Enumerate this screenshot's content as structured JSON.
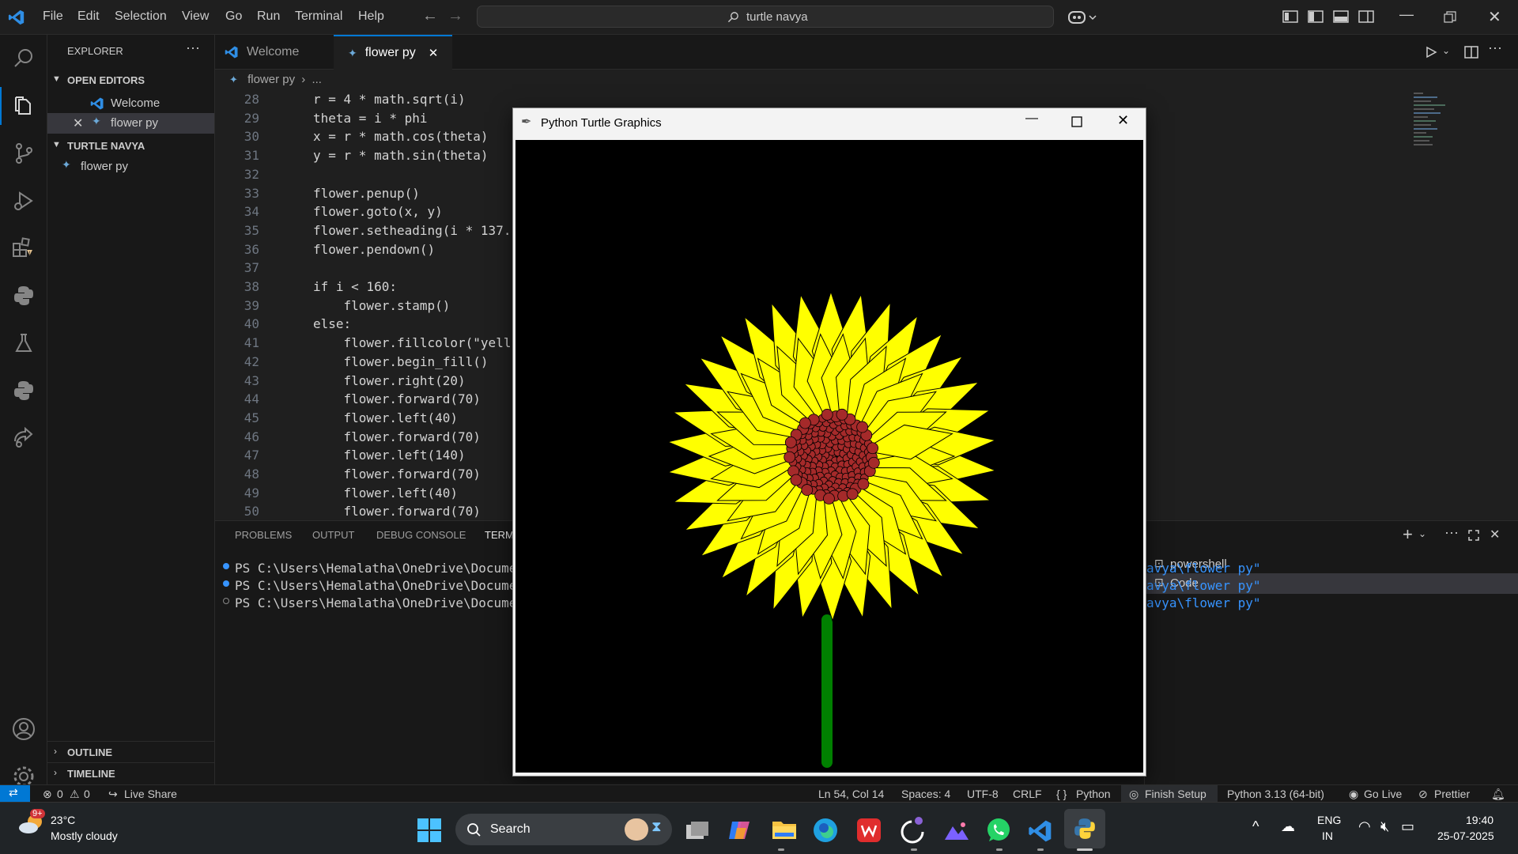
{
  "menu": [
    "File",
    "Edit",
    "Selection",
    "View",
    "Go",
    "Run",
    "Terminal",
    "Help"
  ],
  "search": {
    "text": "turtle navya"
  },
  "sidebar": {
    "title": "EXPLORER",
    "open_editors": "OPEN EDITORS",
    "open_items": [
      "Welcome",
      "flower py"
    ],
    "folder": "TURTLE NAVYA",
    "files": [
      "flower py"
    ],
    "outline": "OUTLINE",
    "timeline": "TIMELINE"
  },
  "tabs": [
    "Welcome",
    "flower py"
  ],
  "breadcrumb": {
    "file": "flower py",
    "more": "..."
  },
  "code_lines": [
    {
      "n": "28",
      "t": "r = 4 * math.sqrt(i)"
    },
    {
      "n": "29",
      "t": "theta = i * phi"
    },
    {
      "n": "30",
      "t": "x = r * math.cos(theta)"
    },
    {
      "n": "31",
      "t": "y = r * math.sin(theta)"
    },
    {
      "n": "32",
      "t": ""
    },
    {
      "n": "33",
      "t": "flower.penup()"
    },
    {
      "n": "34",
      "t": "flower.goto(x, y)"
    },
    {
      "n": "35",
      "t": "flower.setheading(i * 137."
    },
    {
      "n": "36",
      "t": "flower.pendown()"
    },
    {
      "n": "37",
      "t": ""
    },
    {
      "n": "38",
      "t": "if i < 160:"
    },
    {
      "n": "39",
      "t": "    flower.stamp()"
    },
    {
      "n": "40",
      "t": "else:"
    },
    {
      "n": "41",
      "t": "    flower.fillcolor(\"yell"
    },
    {
      "n": "42",
      "t": "    flower.begin_fill()"
    },
    {
      "n": "43",
      "t": "    flower.right(20)"
    },
    {
      "n": "44",
      "t": "    flower.forward(70)"
    },
    {
      "n": "45",
      "t": "    flower.left(40)"
    },
    {
      "n": "46",
      "t": "    flower.forward(70)"
    },
    {
      "n": "47",
      "t": "    flower.left(140)"
    },
    {
      "n": "48",
      "t": "    flower.forward(70)"
    },
    {
      "n": "49",
      "t": "    flower.left(40)"
    },
    {
      "n": "50",
      "t": "    flower.forward(70)"
    }
  ],
  "panel": {
    "tabs": [
      "PROBLEMS",
      "OUTPUT",
      "DEBUG CONSOLE",
      "TERM"
    ],
    "terminal_lines": [
      "PS C:\\Users\\Hemalatha\\OneDrive\\Document",
      "PS C:\\Users\\Hemalatha\\OneDrive\\Document",
      "PS C:\\Users\\Hemalatha\\OneDrive\\Document"
    ],
    "terminal_tails": [
      "avya\\flower py\"",
      "avya\\flower py\"",
      "avya\\flower py\""
    ],
    "terminals": [
      "powershell",
      "Code"
    ]
  },
  "turtle_window": {
    "title": "Python Turtle Graphics"
  },
  "status": {
    "errors": "0",
    "warnings": "0",
    "live_share": "Live Share",
    "position": "Ln 54, Col 14",
    "spaces": "Spaces: 4",
    "encoding": "UTF-8",
    "eol": "CRLF",
    "language": "Python",
    "finish_setup": "Finish Setup",
    "interpreter": "Python 3.13 (64-bit)",
    "go_live": "Go Live",
    "prettier": "Prettier"
  },
  "taskbar": {
    "weather_temp": "23°C",
    "weather_desc": "Mostly cloudy",
    "weather_badge": "9+",
    "search": "Search",
    "lang_top": "ENG",
    "lang_bottom": "IN",
    "time": "19:40",
    "date": "25-07-2025"
  },
  "colors": {
    "accent": "#0078d4",
    "petal": "#ffff00",
    "center": "#a52a2a",
    "stem": "#008000"
  }
}
